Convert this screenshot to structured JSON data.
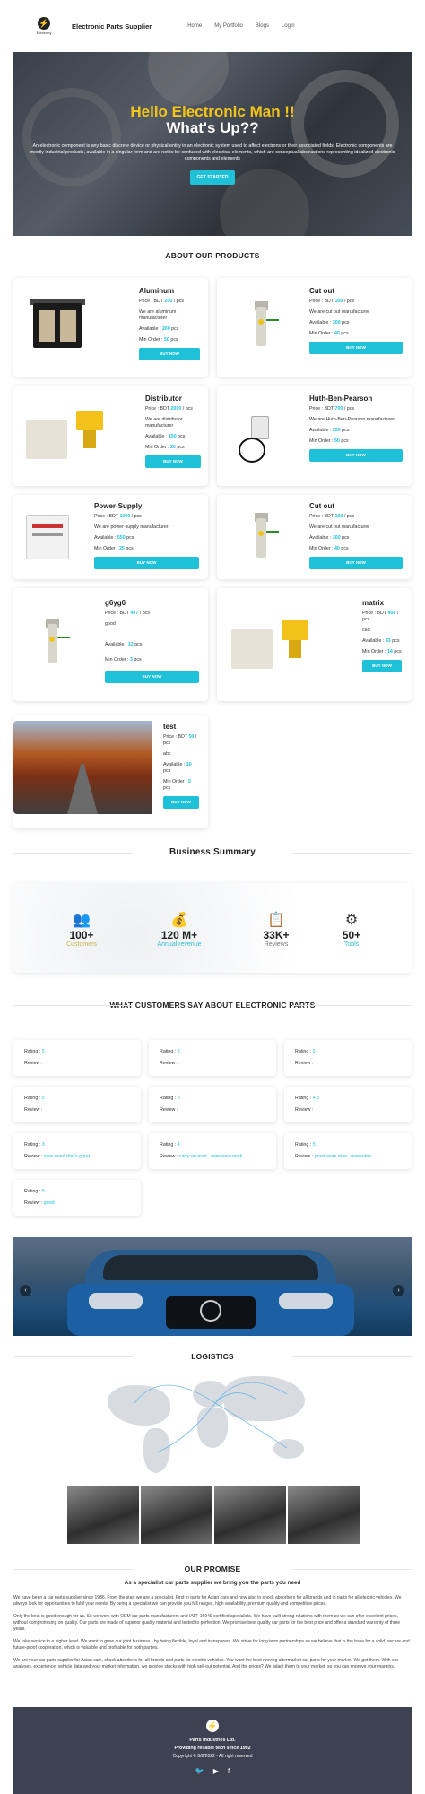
{
  "nav": {
    "brand": "Electronic Parts Supplier",
    "logo_text": "Electrony",
    "links": [
      "Home",
      "My Portfolio",
      "Blogs",
      "Login"
    ]
  },
  "hero": {
    "title1": "Hello Electronic Man !!",
    "title2": "What's Up??",
    "text": "An electronic component is any basic discrete device or physical entity in an electronic system used to affect electrons or their associated fields. Electronic components are mostly industrial products, available in a singular form and are not to be confused with electrical elements, which are conceptual abstractions representing idealized electronic components and elements",
    "button": "GET STARTED"
  },
  "products_title": "ABOUT OUR PRODUCTS",
  "labels": {
    "price": "Price :",
    "available": "Available :",
    "min_order": "Min Order :",
    "buy": "BUY NOW",
    "rating": "Rating :",
    "review": "Review :"
  },
  "products": [
    {
      "name": "Aluminum",
      "price": "BDT",
      "price_val": "250",
      "unit": "/ pcs",
      "desc": "We are aluminum manufacturer",
      "available": "200",
      "avail_unit": "pcs",
      "min": "50",
      "min_unit": "pcs"
    },
    {
      "name": "Cut out",
      "price": "BDT",
      "price_val": "100",
      "unit": "/ pcs",
      "desc": "We are cut out manufacturer",
      "available": "300",
      "avail_unit": "pcs",
      "min": "40",
      "min_unit": "pcs"
    },
    {
      "name": "Distributor",
      "price": "BDT",
      "price_val": "2000",
      "unit": "/ pcs",
      "desc": "We are distributor manufacturer",
      "available": "150",
      "avail_unit": "pcs",
      "min": "20",
      "min_unit": "pcs"
    },
    {
      "name": "Huth-Ben-Pearson",
      "price": "BDT",
      "price_val": "700",
      "unit": "/ pcs",
      "desc": "We are Huth-Ben-Pearson manufacturer",
      "available": "250",
      "avail_unit": "pcs",
      "min": "50",
      "min_unit": "pcs"
    },
    {
      "name": "Power-Supply",
      "price": "BDT",
      "price_val": "1000",
      "unit": "/ pcs",
      "desc": "We are power-supply manufacturer",
      "available": "550",
      "avail_unit": "pcs",
      "min": "25",
      "min_unit": "pcs"
    },
    {
      "name": "Cut out",
      "price": "BDT",
      "price_val": "100",
      "unit": "/ pcs",
      "desc": "We are cut out manufacturer",
      "available": "300",
      "avail_unit": "pcs",
      "min": "40",
      "min_unit": "pcs"
    },
    {
      "name": "g6yg6",
      "price": "BDT",
      "price_val": "407",
      "unit": "/ pcs",
      "desc": "good",
      "available": "12",
      "avail_unit": "pcs",
      "min": "3",
      "min_unit": "pcs"
    },
    {
      "name": "matrix",
      "price": "BDT",
      "price_val": "458",
      "unit": "/ pcs",
      "desc": "calc",
      "available": "43",
      "avail_unit": "pcs",
      "min": "14",
      "min_unit": "pcs"
    },
    {
      "name": "test",
      "price": "BDT",
      "price_val": "50",
      "unit": "/ pcs",
      "desc": "abc",
      "available": "10",
      "avail_unit": "pcs",
      "min": "5",
      "min_unit": "pcs"
    }
  ],
  "summary": {
    "title": "Business Summary",
    "stats": [
      {
        "num": "100+",
        "label": "Customers",
        "color": "#c7b54a"
      },
      {
        "num": "120 M+",
        "label": "Annual revenue",
        "color": "#5bc8d8"
      },
      {
        "num": "33K+",
        "label": "Reviews",
        "color": "#777777"
      },
      {
        "num": "50+",
        "label": "Tools",
        "color": "#5bc8d8"
      }
    ]
  },
  "reviews_title": "WHAT CUSTOMERS SAY ABOUT ELECTRONIC PARTS",
  "reviews": [
    {
      "rating": "5",
      "review": ""
    },
    {
      "rating": "3",
      "review": ""
    },
    {
      "rating": "5",
      "review": ""
    },
    {
      "rating": "5",
      "review": ""
    },
    {
      "rating": "5",
      "review": ""
    },
    {
      "rating": "4.5",
      "review": ""
    },
    {
      "rating": "3",
      "review": "wow man! that's great"
    },
    {
      "rating": "4",
      "review": "carry on man ..awesome work"
    },
    {
      "rating": "5",
      "review": "good work man ..awesome"
    },
    {
      "rating": "5",
      "review": "good"
    }
  ],
  "logistics_title": "LOGISTICS",
  "promise": {
    "title": "OUR PROMISE",
    "subtitle": "As a specialist car parts supplier we bring you the parts you need",
    "p1": "We have been a car parts supplier since 1986. From the start we are a specialist. First in parts for Asian cars and now also in shock absorbers for all brands and in parts for all electric vehicles. We always look for opportunities to fulfil your needs. By being a specialist we can provide you full ranges, high availability, premium quality and competitive prices.",
    "p2": "Only the best is good enough for us. So we work with OEM car parts manufacturers and IATF 16949 certified specialists. We have built strong relations with them so we can offer excellent prices, without compromising on quality. Our parts are made of superior quality material and tested to perfection. We promise best quality car parts for the best price and offer a standard warranty of three years.",
    "p3": "We take service to a higher level. We want to grow our joint business - by being flexible, loyal and transparent. We strive for long term partnerships as we believe that is the base for a solid, secure and future-proof cooperation, which is valuable and profitable for both parties.",
    "p4": "We are your car parts supplier for Asian cars, shock absorbers for all brands and parts for electric vehicles. You want the best moving aftermarket car parts for your market. We got them. With our analyses, experience, vehicle data and your market information, we provide stocks with high sell-out potential. And the prices? We adapt them to your market, so you can improve your margins."
  },
  "footer": {
    "company": "Parts Industries Ltd.",
    "tagline": "Providing reliable tech since 1992",
    "copyright": "Copyright © 8/8/2022 - All right reserved"
  }
}
